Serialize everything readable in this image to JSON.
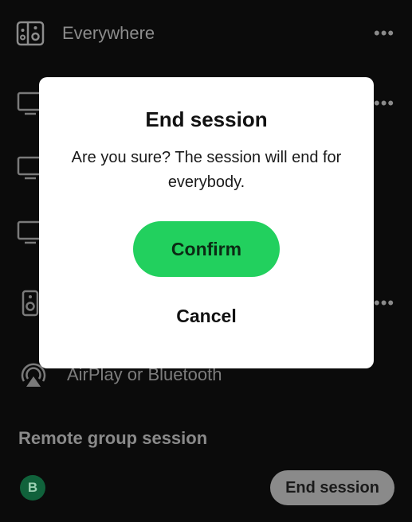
{
  "devices": [
    {
      "label": "Everywhere",
      "icon": "speaker-group-icon"
    },
    {
      "label": "",
      "icon": "monitor-icon"
    },
    {
      "label": "",
      "icon": "monitor-icon"
    },
    {
      "label": "",
      "icon": "monitor-icon"
    },
    {
      "label": "",
      "icon": "speaker-icon"
    },
    {
      "label": "AirPlay or Bluetooth",
      "icon": "airplay-icon"
    }
  ],
  "session": {
    "section_title": "Remote group session",
    "avatar_initial": "B",
    "end_session_label": "End session"
  },
  "dialog": {
    "title": "End session",
    "message": "Are you sure? The session will end for everybody.",
    "confirm_label": "Confirm",
    "cancel_label": "Cancel"
  },
  "colors": {
    "background": "#0b0b0b",
    "accent_green": "#22d05e",
    "dialog_background": "#ffffff",
    "avatar_green": "#10623b"
  }
}
